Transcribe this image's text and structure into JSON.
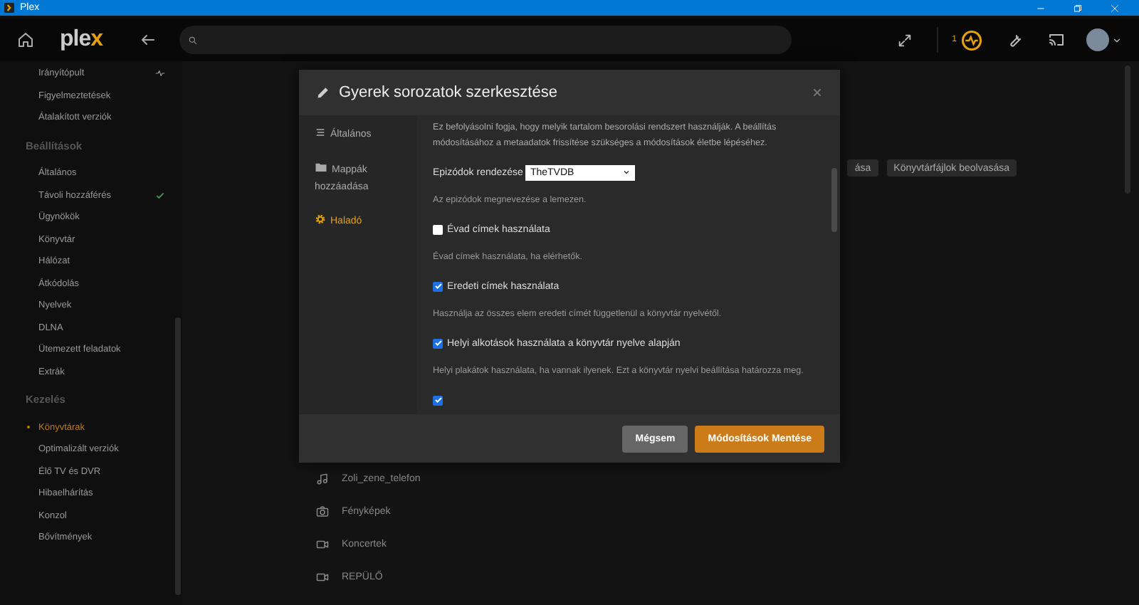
{
  "window": {
    "title": "Plex"
  },
  "topbar": {
    "logo": "plex",
    "activity_count": "1"
  },
  "sidebar": {
    "sections": [
      {
        "items": [
          {
            "label": "Irányítópult",
            "kind": "activity",
            "selected": false
          },
          {
            "label": "Figyelmeztetések",
            "kind": "plain",
            "selected": false
          },
          {
            "label": "Átalakított verziók",
            "kind": "plain",
            "selected": false
          }
        ]
      },
      {
        "heading": "Beállítások",
        "items": [
          {
            "label": "Általános",
            "kind": "plain",
            "selected": false
          },
          {
            "label": "Távoli hozzáférés",
            "kind": "ok",
            "selected": false
          },
          {
            "label": "Ügynökök",
            "kind": "plain",
            "selected": false
          },
          {
            "label": "Könyvtár",
            "kind": "plain",
            "selected": false
          },
          {
            "label": "Hálózat",
            "kind": "plain",
            "selected": false
          },
          {
            "label": "Átkódolás",
            "kind": "plain",
            "selected": false
          },
          {
            "label": "Nyelvek",
            "kind": "plain",
            "selected": false
          },
          {
            "label": "DLNA",
            "kind": "plain",
            "selected": false
          },
          {
            "label": "Ütemezett feladatok",
            "kind": "plain",
            "selected": false
          },
          {
            "label": "Extrák",
            "kind": "plain",
            "selected": false
          }
        ]
      },
      {
        "heading": "Kezelés",
        "items": [
          {
            "label": "Könyvtárak",
            "kind": "plain",
            "selected": true
          },
          {
            "label": "Optimalizált verziók",
            "kind": "plain",
            "selected": false
          },
          {
            "label": "Élő TV és DVR",
            "kind": "plain",
            "selected": false
          },
          {
            "label": "Hibaelhárítás",
            "kind": "plain",
            "selected": false
          },
          {
            "label": "Konzol",
            "kind": "plain",
            "selected": false
          },
          {
            "label": "Bővítmények",
            "kind": "plain",
            "selected": false
          }
        ]
      }
    ]
  },
  "main": {
    "actions": [
      {
        "label": "ása"
      },
      {
        "label": "Könyvtárfájlok beolvasása"
      }
    ],
    "libraries": [
      {
        "name": "Zoli_zene_telefon",
        "kind": "music"
      },
      {
        "name": "Fényképek",
        "kind": "photo"
      },
      {
        "name": "Koncertek",
        "kind": "video"
      },
      {
        "name": "REPÜLŐ",
        "kind": "video"
      }
    ]
  },
  "modal": {
    "title": "Gyerek sorozatok szerkesztése",
    "nav": [
      {
        "label": "Általános",
        "kind": "list",
        "selected": false
      },
      {
        "label": "Mappák hozzáadása",
        "kind": "folder",
        "selected": false
      },
      {
        "label": "Haladó",
        "kind": "gear",
        "selected": true
      }
    ],
    "intro": "Ez befolyásolni fogja, hogy melyik tartalom besorolási rendszert használják. A beállítás módosításához a metaadatok frissítése szükséges a módosítások életbe lépéséhez.",
    "fields": [
      {
        "kind": "select",
        "label": "Epizódok rendezése",
        "value": "TheTVDB",
        "hint": "Az epizódok megnevezése a lemezen."
      },
      {
        "kind": "checkbox",
        "label": "Évad címek használata",
        "checked": false,
        "hint": "Évad címek használata, ha elérhetők."
      },
      {
        "kind": "checkbox",
        "label": "Eredeti címek használata",
        "checked": true,
        "hint": "Használja az összes elem eredeti címét függetlenül a könyvtár nyelvétől."
      },
      {
        "kind": "checkbox",
        "label": "Helyi alkotások használata a könyvtár nyelve alapján",
        "checked": true,
        "hint": "Helyi plakátok használata, ha vannak ilyenek. Ezt a könyvtár nyelvi beállítása határozza meg."
      },
      {
        "kind": "checkbox",
        "checked": true
      }
    ],
    "buttons": [
      {
        "label": "Mégsem",
        "kind": "secondary"
      },
      {
        "label": "Módosítások Mentése",
        "kind": "primary"
      }
    ]
  }
}
